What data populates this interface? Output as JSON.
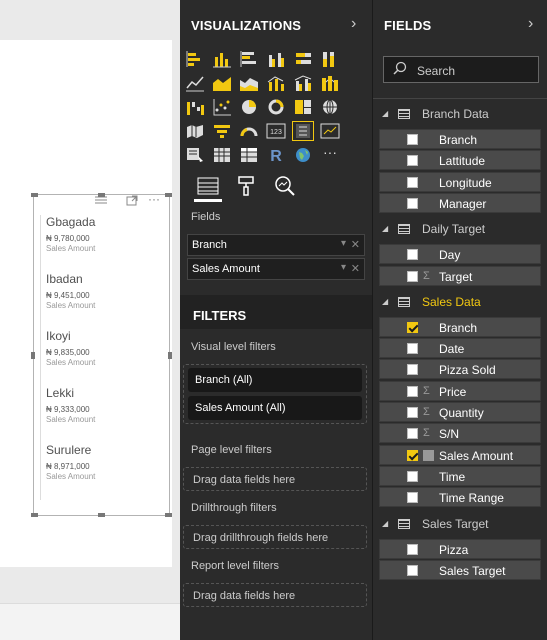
{
  "canvas": {
    "card_items": [
      {
        "name": "Gbagada",
        "value": "₦ 9,780,000",
        "label": "Sales Amount"
      },
      {
        "name": "Ibadan",
        "value": "₦ 9,451,000",
        "label": "Sales Amount"
      },
      {
        "name": "Ikoyi",
        "value": "₦ 9,835,000",
        "label": "Sales Amount"
      },
      {
        "name": "Lekki",
        "value": "₦ 9,333,000",
        "label": "Sales Amount"
      },
      {
        "name": "Surulere",
        "value": "₦ 8,971,000",
        "label": "Sales Amount"
      }
    ]
  },
  "visualizations": {
    "title": "VISUALIZATIONS",
    "chevron": "›",
    "fields_label": "Fields",
    "wells": [
      {
        "label": "Branch"
      },
      {
        "label": "Sales Amount"
      }
    ],
    "filters": {
      "title": "FILTERS",
      "visual_level": "Visual level filters",
      "visual_items": [
        "Branch (All)",
        "Sales Amount (All)"
      ],
      "page_level": "Page level filters",
      "page_drop": "Drag data fields here",
      "drillthrough": "Drillthrough filters",
      "drillthrough_drop": "Drag drillthrough fields here",
      "report_level": "Report level filters",
      "report_drop": "Drag data fields here"
    },
    "r_letter": "R",
    "table_123": "123",
    "more": "···"
  },
  "fields": {
    "title": "FIELDS",
    "chevron": "›",
    "search_placeholder": "Search",
    "tables": [
      {
        "name": "Branch Data",
        "active": false,
        "fields": [
          {
            "name": "Branch",
            "checked": false,
            "sigma": false
          },
          {
            "name": "Lattitude",
            "checked": false,
            "sigma": false
          },
          {
            "name": "Longitude",
            "checked": false,
            "sigma": false
          },
          {
            "name": "Manager",
            "checked": false,
            "sigma": false
          }
        ]
      },
      {
        "name": "Daily Target",
        "active": false,
        "fields": [
          {
            "name": "Day",
            "checked": false,
            "sigma": false
          },
          {
            "name": "Target",
            "checked": false,
            "sigma": true
          }
        ]
      },
      {
        "name": "Sales Data",
        "active": true,
        "fields": [
          {
            "name": "Branch",
            "checked": true,
            "sigma": false
          },
          {
            "name": "Date",
            "checked": false,
            "sigma": false
          },
          {
            "name": "Pizza Sold",
            "checked": false,
            "sigma": false
          },
          {
            "name": "Price",
            "checked": false,
            "sigma": true
          },
          {
            "name": "Quantity",
            "checked": false,
            "sigma": true
          },
          {
            "name": "S/N",
            "checked": false,
            "sigma": true
          },
          {
            "name": "Sales Amount",
            "checked": true,
            "sigma": false,
            "calc": true
          },
          {
            "name": "Time",
            "checked": false,
            "sigma": false
          },
          {
            "name": "Time Range",
            "checked": false,
            "sigma": false
          }
        ]
      },
      {
        "name": "Sales Target",
        "active": false,
        "fields": [
          {
            "name": "Pizza",
            "checked": false,
            "sigma": false
          },
          {
            "name": "Sales Target",
            "checked": false,
            "sigma": false
          }
        ]
      }
    ]
  },
  "colors": {
    "accent": "#f2c811",
    "pane_bg": "#2b2b2b",
    "canvas_bg": "#eaeaea"
  }
}
